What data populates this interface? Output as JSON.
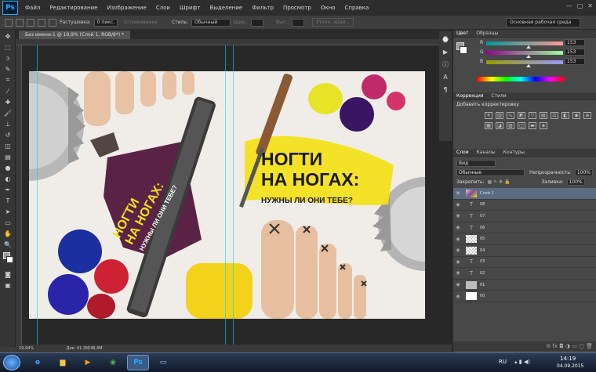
{
  "menu": {
    "app_icon": "Ps",
    "items": [
      "Файл",
      "Редактирование",
      "Изображение",
      "Слои",
      "Шрифт",
      "Выделение",
      "Фильтр",
      "Просмотр",
      "Окно",
      "Справка"
    ]
  },
  "options": {
    "feather_label": "Растушевка:",
    "feather_value": "0 пикс.",
    "antialias": "Сглаживание",
    "style_label": "Стиль:",
    "style_value": "Обычный",
    "width_label": "Шир.:",
    "height_label": "Выс.:",
    "refine": "Уточн. край...",
    "workspace": "Основная рабочая среда"
  },
  "document": {
    "tab": "Без имени-1 @ 19,9% (Слой 1, RGB/8*) *",
    "zoom": "19,94%",
    "doc_size": "Док: 41,3M/48,4M"
  },
  "poster": {
    "title_l1": "НОГТИ",
    "title_l2": "НА НОГАХ:",
    "subtitle": "НУЖНЫ ЛИ ОНИ ТЕБЕ?",
    "rotated_l1": "НОГТИ",
    "rotated_l2": "НА НОГАХ:",
    "rotated_l3": "НУЖНЫ ЛИ ОНИ ТЕБЕ?"
  },
  "color_panel": {
    "tab_active": "Цвет",
    "tab2": "Образцы",
    "r_label": "R",
    "g_label": "G",
    "b_label": "B",
    "r": "153",
    "g": "153",
    "b": "153"
  },
  "adjust_panel": {
    "tab_active": "Коррекция",
    "tab2": "Стили",
    "add": "Добавить корректировку"
  },
  "layers_panel": {
    "tab_active": "Слои",
    "tab2": "Каналы",
    "tab3": "Контуры",
    "kind": "Вид",
    "blend": "Обычные",
    "opacity_label": "Непрозрачность:",
    "opacity": "100%",
    "lock_label": "Закрепить:",
    "fill_label": "Заливка:",
    "fill": "100%",
    "layers": [
      {
        "name": "Слой 1",
        "type": "image",
        "sel": true
      },
      {
        "name": "08",
        "type": "text"
      },
      {
        "name": "07",
        "type": "text"
      },
      {
        "name": "06",
        "type": "text"
      },
      {
        "name": "05",
        "type": "trans"
      },
      {
        "name": "04",
        "type": "trans"
      },
      {
        "name": "03",
        "type": "text"
      },
      {
        "name": "02",
        "type": "text"
      },
      {
        "name": "01",
        "type": "gray"
      },
      {
        "name": "00",
        "type": "white"
      }
    ]
  },
  "taskbar": {
    "lang": "RU",
    "time": "14:19",
    "date": "04.09.2015"
  }
}
